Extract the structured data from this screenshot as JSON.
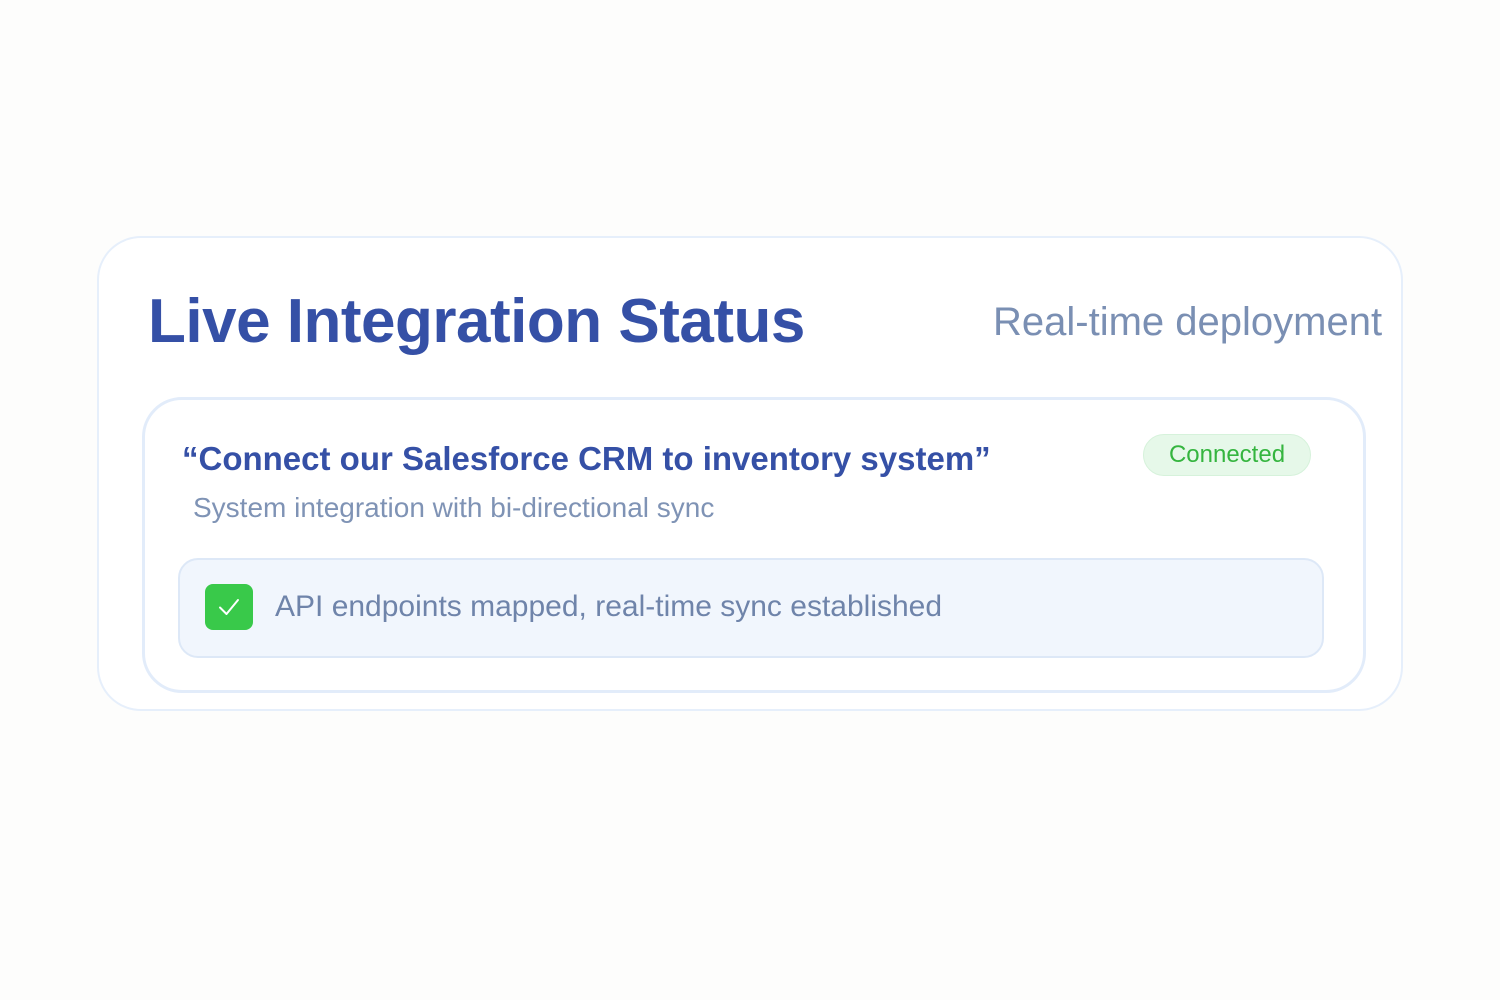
{
  "header": {
    "title": "Live Integration Status",
    "subtitle": "Real-time deployment"
  },
  "integration": {
    "request": "“Connect our Salesforce CRM to inventory system”",
    "description": "System integration with bi-directional sync",
    "status": "Connected",
    "result": "API endpoints mapped, real-time sync established"
  },
  "colors": {
    "title": "#3550a6",
    "muted_text": "#7a8fb3",
    "status_green": "#35b53f",
    "status_badge_bg": "#e6f8e9",
    "check_green": "#39c94a",
    "panel_bg": "#f1f6fd"
  },
  "icons": {
    "check": "check-icon"
  }
}
